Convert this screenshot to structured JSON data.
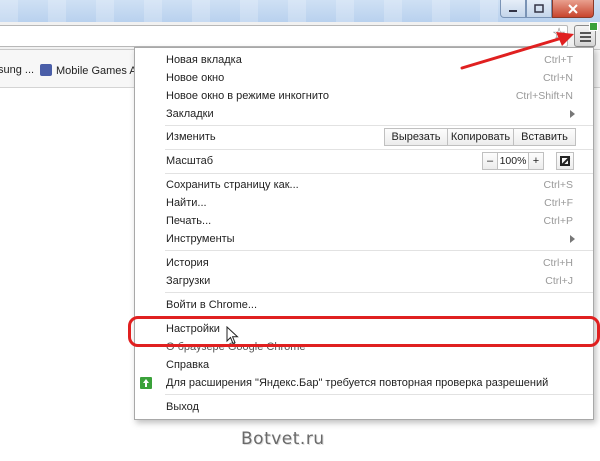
{
  "bookmarks": {
    "item1": "sung ...",
    "item2": "Mobile Games A"
  },
  "menu": {
    "new_tab": {
      "label": "Новая вкладка",
      "shortcut": "Ctrl+T"
    },
    "new_window": {
      "label": "Новое окно",
      "shortcut": "Ctrl+N"
    },
    "incognito": {
      "label": "Новое окно в режиме инкогнито",
      "shortcut": "Ctrl+Shift+N"
    },
    "bookmarks": {
      "label": "Закладки"
    },
    "edit": {
      "label": "Изменить",
      "cut": "Вырезать",
      "copy": "Копировать",
      "paste": "Вставить"
    },
    "zoom": {
      "label": "Масштаб",
      "minus": "–",
      "value": "100%",
      "plus": "+"
    },
    "save_page": {
      "label": "Сохранить страницу как...",
      "shortcut": "Ctrl+S"
    },
    "find": {
      "label": "Найти...",
      "shortcut": "Ctrl+F"
    },
    "print": {
      "label": "Печать...",
      "shortcut": "Ctrl+P"
    },
    "tools": {
      "label": "Инструменты"
    },
    "history": {
      "label": "История",
      "shortcut": "Ctrl+H"
    },
    "downloads": {
      "label": "Загрузки",
      "shortcut": "Ctrl+J"
    },
    "sign_in": {
      "label": "Войти в Chrome..."
    },
    "settings": {
      "label": "Настройки"
    },
    "about": {
      "label": "О браузере Google Chrome"
    },
    "help": {
      "label": "Справка"
    },
    "extension_notice": {
      "label": "Для расширения \"Яндекс.Бар\" требуется повторная проверка разрешений"
    },
    "exit": {
      "label": "Выход"
    }
  },
  "watermark": "Botvet.ru",
  "colors": {
    "highlight": "#e02020",
    "update_badge": "#3aa13a"
  }
}
